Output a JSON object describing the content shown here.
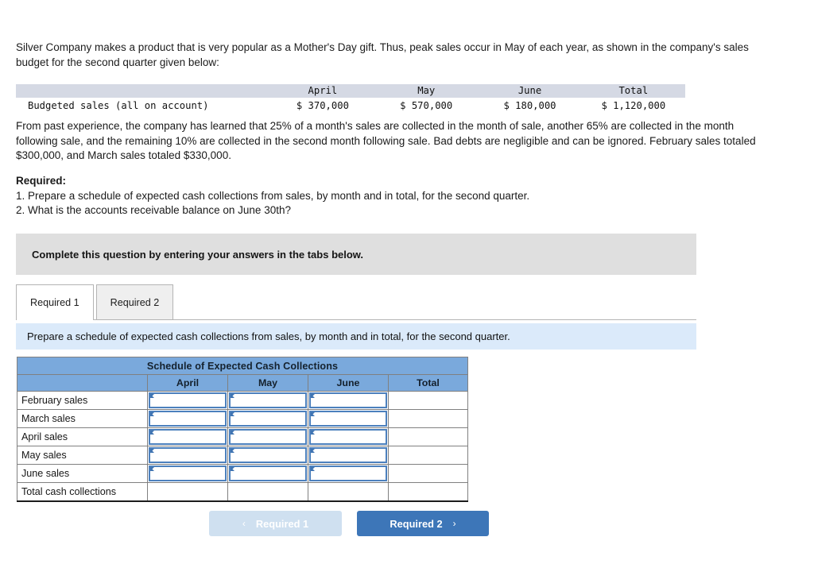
{
  "intro": {
    "paragraph": "Silver Company makes a product that is very popular as a Mother's Day gift. Thus, peak sales occur in May of each year, as shown in the company's sales budget for the second quarter given below:"
  },
  "budget_table": {
    "columns": [
      "",
      "April",
      "May",
      "June",
      "Total"
    ],
    "rows": [
      {
        "label": "Budgeted sales (all on account)",
        "values": [
          "$ 370,000",
          "$ 570,000",
          "$ 180,000",
          "$ 1,120,000"
        ]
      }
    ]
  },
  "details": {
    "paragraph": "From past experience, the company has learned that 25% of a month's sales are collected in the month of sale, another 65% are collected in the month following sale, and the remaining 10% are collected in the second month following sale. Bad debts are negligible and can be ignored. February sales totaled $300,000, and March sales totaled $330,000."
  },
  "required": {
    "heading": "Required:",
    "items": [
      "1. Prepare a schedule of expected cash collections from sales, by month and in total, for the second quarter.",
      "2. What is the accounts receivable balance on June 30th?"
    ]
  },
  "banner": {
    "text": "Complete this question by entering your answers in the tabs below."
  },
  "tabs": {
    "items": [
      {
        "label": "Required 1",
        "active": true
      },
      {
        "label": "Required 2",
        "active": false
      }
    ]
  },
  "instruction": {
    "text": "Prepare a schedule of expected cash collections from sales, by month and in total, for the second quarter."
  },
  "schedule": {
    "title": "Schedule of Expected Cash Collections",
    "columns": [
      "",
      "April",
      "May",
      "June",
      "Total"
    ],
    "rows": [
      {
        "label": "February sales",
        "cells": [
          "",
          "",
          "",
          ""
        ],
        "inputs": [
          true,
          true,
          true,
          false
        ]
      },
      {
        "label": "March sales",
        "cells": [
          "",
          "",
          "",
          ""
        ],
        "inputs": [
          true,
          true,
          true,
          false
        ]
      },
      {
        "label": "April sales",
        "cells": [
          "",
          "",
          "",
          ""
        ],
        "inputs": [
          true,
          true,
          true,
          false
        ]
      },
      {
        "label": "May sales",
        "cells": [
          "",
          "",
          "",
          ""
        ],
        "inputs": [
          true,
          true,
          true,
          false
        ]
      },
      {
        "label": "June sales",
        "cells": [
          "",
          "",
          "",
          ""
        ],
        "inputs": [
          true,
          true,
          true,
          false
        ]
      },
      {
        "label": "Total cash collections",
        "cells": [
          "",
          "",
          "",
          ""
        ],
        "inputs": [
          false,
          false,
          false,
          false
        ]
      }
    ]
  },
  "nav": {
    "prev_label": "Required 1",
    "prev_chevron": "‹",
    "next_label": "Required 2",
    "next_chevron": "›"
  },
  "colors": {
    "header_blue": "#7aa9dc",
    "instruction_blue": "#dbeafa",
    "banner_gray": "#dfdfdf",
    "budget_header_gray": "#d5d9e4",
    "button_active": "#3d76b8",
    "button_disabled": "#cfe0f0",
    "input_border": "#4c80bd"
  }
}
